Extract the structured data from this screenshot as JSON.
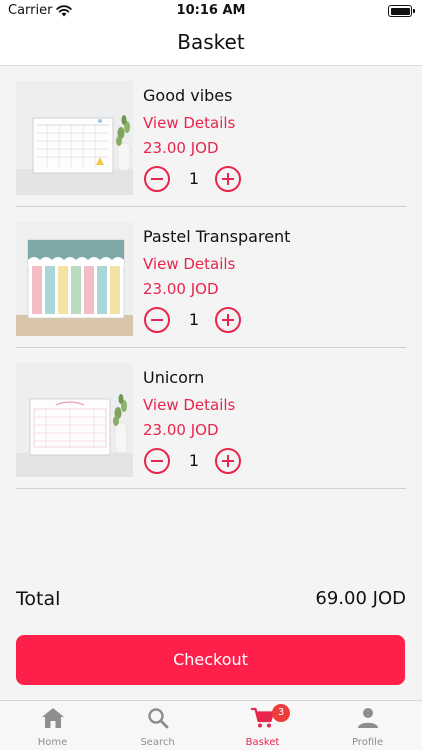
{
  "status_bar": {
    "carrier": "Carrier",
    "time": "10:16 AM"
  },
  "nav": {
    "title": "Basket"
  },
  "items": [
    {
      "name": "Good vibes",
      "details_label": "View Details",
      "price": "23.00 JOD",
      "quantity": "1"
    },
    {
      "name": "Pastel Transparent",
      "details_label": "View Details",
      "price": "23.00 JOD",
      "quantity": "1"
    },
    {
      "name": "Unicorn",
      "details_label": "View Details",
      "price": "23.00 JOD",
      "quantity": "1"
    }
  ],
  "total": {
    "label": "Total",
    "value": "69.00 JOD"
  },
  "checkout": {
    "label": "Checkout"
  },
  "tabs": [
    {
      "label": "Home",
      "icon": "home-icon"
    },
    {
      "label": "Search",
      "icon": "search-icon"
    },
    {
      "label": "Basket",
      "icon": "cart-icon",
      "badge": "3"
    },
    {
      "label": "Profile",
      "icon": "person-icon"
    }
  ],
  "colors": {
    "accent": "#e8254c",
    "checkout_bg": "#ff1f4b",
    "badge": "#ef3b3b",
    "inactive_tab": "#8e8e8e"
  }
}
